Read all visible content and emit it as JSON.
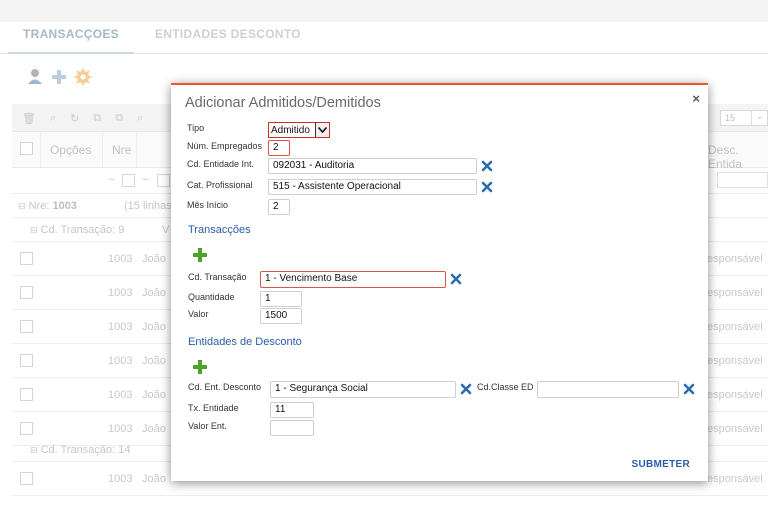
{
  "tabs": [
    "TRANSACÇOES",
    "ENTIDADES DESCONTO"
  ],
  "grid": {
    "pager_value": "15",
    "headers": {
      "opcoes": "Opções",
      "nre": "Nre",
      "desc_entidade": "Desc. Entida"
    },
    "filter_tilde": "~",
    "group_nre": {
      "prefix": "Nre:",
      "value": "1003",
      "count": "(15 linhas"
    },
    "group_transacao_1": {
      "label": "Cd. Transação: 9",
      "tail": "V"
    },
    "group_transacao_2": {
      "label": "Cd. Transação: 14"
    },
    "rows": [
      {
        "nre": "1003",
        "name": "João",
        "desc": "esponsável"
      },
      {
        "nre": "1003",
        "name": "João",
        "desc": "esponsável"
      },
      {
        "nre": "1003",
        "name": "João",
        "desc": "esponsável"
      },
      {
        "nre": "1003",
        "name": "João",
        "desc": "esponsável"
      },
      {
        "nre": "1003",
        "name": "João",
        "desc": "esponsável"
      },
      {
        "nre": "1003",
        "name": "João",
        "desc": "esponsável"
      }
    ],
    "row_after": {
      "nre": "1003",
      "name": "João",
      "desc": "esponsável"
    }
  },
  "modal": {
    "title": "Adicionar Admitidos/Demitidos",
    "close": "×",
    "tipo_label": "Tipo",
    "tipo_value": "Admitido",
    "num_empregados_label": "Núm. Empregados",
    "num_empregados_value": "2",
    "cd_entidade_label": "Cd. Entidade Int.",
    "cd_entidade_value": "092031 - Auditoria",
    "cat_profissional_label": "Cat. Profissional",
    "cat_profissional_value": "515 - Assistente Operacional",
    "mes_inicio_label": "Mês Início",
    "mes_inicio_value": "2",
    "transacoes_title": "Transacções",
    "cd_transacao_label": "Cd. Transação",
    "cd_transacao_value": "1 - Vencimento Base",
    "quantidade_label": "Quantidade",
    "quantidade_value": "1",
    "valor_label": "Valor",
    "valor_value": "1500",
    "entidades_title": "Entidades de Desconto",
    "cd_ent_desconto_label": "Cd. Ent. Desconto",
    "cd_ent_desconto_value": "1 - Segurança Social",
    "cd_classe_label": "Cd.Classe ED",
    "cd_classe_value": "",
    "tx_entidade_label": "Tx. Entidade",
    "tx_entidade_value": "11",
    "valor_ent_label": "Valor Ent.",
    "valor_ent_value": "",
    "submit": "SUBMETER"
  },
  "colors": {
    "accent": "#2a5da8",
    "modal_top_border": "#e8562a",
    "error_border": "#d9534f",
    "plus_green": "#4ca12a",
    "x_blue": "#2b6cb0"
  }
}
